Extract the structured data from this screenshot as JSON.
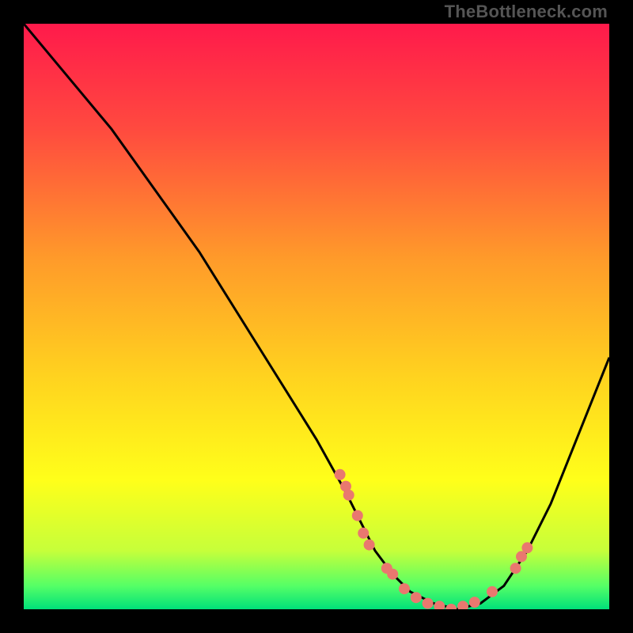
{
  "watermark": "TheBottleneck.com",
  "chart_data": {
    "type": "line",
    "title": "",
    "xlabel": "",
    "ylabel": "",
    "xlim": [
      0,
      100
    ],
    "ylim": [
      0,
      100
    ],
    "curve": {
      "name": "bottleneck-curve",
      "x": [
        0,
        5,
        10,
        15,
        20,
        25,
        30,
        35,
        40,
        45,
        50,
        55,
        58,
        60,
        63,
        66,
        70,
        74,
        78,
        82,
        86,
        90,
        94,
        98,
        100
      ],
      "y": [
        100,
        94,
        88,
        82,
        75,
        68,
        61,
        53,
        45,
        37,
        29,
        20,
        14,
        10,
        6,
        3,
        1,
        0,
        1,
        4,
        10,
        18,
        28,
        38,
        43
      ]
    },
    "markers": {
      "name": "highlight-points",
      "color": "#e9786f",
      "points": [
        {
          "x": 54,
          "y": 23
        },
        {
          "x": 55,
          "y": 21
        },
        {
          "x": 55.5,
          "y": 19.5
        },
        {
          "x": 57,
          "y": 16
        },
        {
          "x": 58,
          "y": 13
        },
        {
          "x": 59,
          "y": 11
        },
        {
          "x": 62,
          "y": 7
        },
        {
          "x": 63,
          "y": 6
        },
        {
          "x": 65,
          "y": 3.5
        },
        {
          "x": 67,
          "y": 2
        },
        {
          "x": 69,
          "y": 1
        },
        {
          "x": 71,
          "y": 0.5
        },
        {
          "x": 73,
          "y": 0
        },
        {
          "x": 75,
          "y": 0.5
        },
        {
          "x": 77,
          "y": 1.2
        },
        {
          "x": 80,
          "y": 3
        },
        {
          "x": 84,
          "y": 7
        },
        {
          "x": 85,
          "y": 9
        },
        {
          "x": 86,
          "y": 10.5
        }
      ]
    },
    "gradient_stops": [
      {
        "offset": 0,
        "color": "#ff1a4b"
      },
      {
        "offset": 0.18,
        "color": "#ff4a3f"
      },
      {
        "offset": 0.4,
        "color": "#ff9a2a"
      },
      {
        "offset": 0.6,
        "color": "#ffd21f"
      },
      {
        "offset": 0.78,
        "color": "#ffff1a"
      },
      {
        "offset": 0.9,
        "color": "#c6ff3a"
      },
      {
        "offset": 0.96,
        "color": "#55ff66"
      },
      {
        "offset": 1.0,
        "color": "#00e07a"
      }
    ]
  }
}
